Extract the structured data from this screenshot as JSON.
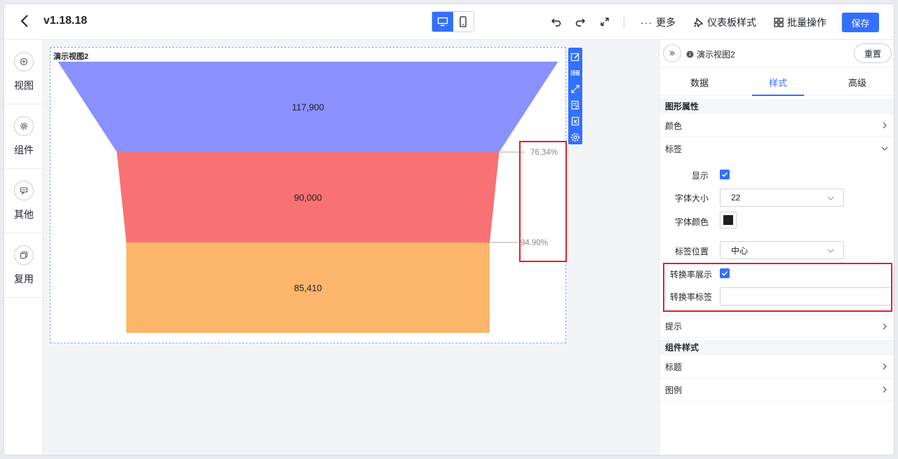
{
  "header": {
    "version": "v1.18.18",
    "more_label": "更多",
    "dashboard_style_label": "仪表板样式",
    "batch_label": "批量操作",
    "save_label": "保存"
  },
  "leftrail": {
    "items": [
      {
        "label": "视图",
        "icon": "plus-circle-icon"
      },
      {
        "label": "组件",
        "icon": "gear-icon"
      },
      {
        "label": "其他",
        "icon": "chat-icon"
      },
      {
        "label": "复用",
        "icon": "copy-icon"
      }
    ]
  },
  "canvas": {
    "view_title": "演示视图2"
  },
  "chart_data": {
    "type": "funnel",
    "stages": [
      {
        "value": 117900,
        "label": "117,900",
        "color": "#8a91fe"
      },
      {
        "value": 90000,
        "label": "90,000",
        "color": "#f87174"
      },
      {
        "value": 85410,
        "label": "85,410",
        "color": "#fbb66b"
      }
    ],
    "conversion_rates": [
      "76.34%",
      "94.90%"
    ]
  },
  "panel": {
    "title": "演示视图2",
    "reset_label": "重置",
    "tabs": [
      "数据",
      "样式",
      "高级"
    ],
    "active_tab": "样式",
    "section_graphic": "图形属性",
    "color_label": "颜色",
    "label_label": "标签",
    "show_label": "显示",
    "font_size_label": "字体大小",
    "font_size_value": "22",
    "font_color_label": "字体颜色",
    "font_color": "#1f1f1f",
    "label_position_label": "标签位置",
    "label_position_value": "中心",
    "conversion_show_label": "转换率展示",
    "conversion_label_label": "转换率标签",
    "conversion_label_value": "",
    "tooltip_label": "提示",
    "section_component": "组件样式",
    "title_label": "标题",
    "legend_label": "图例"
  },
  "colors": {
    "accent": "#3370ff",
    "highlight": "#e0202a"
  }
}
